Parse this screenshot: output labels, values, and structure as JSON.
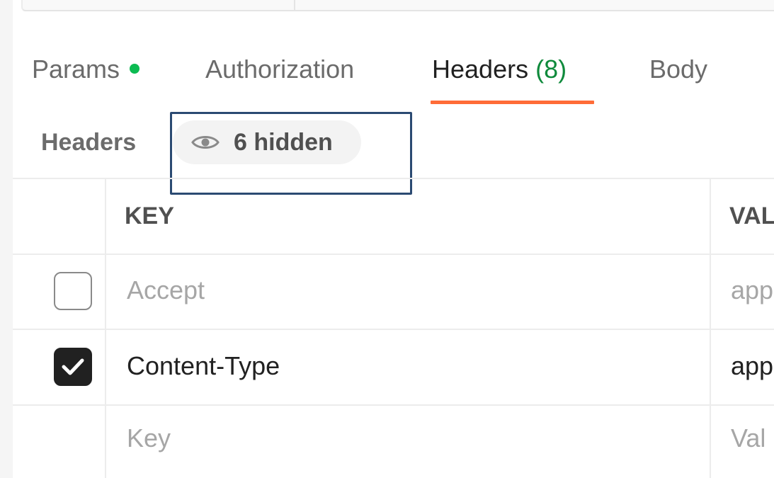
{
  "tabs": {
    "params": {
      "label": "Params",
      "has_indicator": true,
      "indicator_color": "#0cbb52"
    },
    "authorization": {
      "label": "Authorization"
    },
    "headers": {
      "label": "Headers",
      "count": "(8)",
      "active": true,
      "underline_color": "#ff6c37"
    },
    "body": {
      "label": "Body"
    }
  },
  "headers_section": {
    "title": "Headers",
    "hidden_toggle": {
      "icon": "eye-icon",
      "label": "6 hidden"
    }
  },
  "table": {
    "columns": {
      "key": "KEY",
      "value": "VAL"
    },
    "rows": [
      {
        "checked": false,
        "key": "Accept",
        "value": "app"
      },
      {
        "checked": true,
        "key": "Content-Type",
        "value": "app"
      }
    ],
    "new_row": {
      "key_placeholder": "Key",
      "value_placeholder": "Val"
    }
  },
  "colors": {
    "accent": "#ff6c37",
    "count_green": "#0f8a3c",
    "highlight_border": "#2b4a72"
  }
}
